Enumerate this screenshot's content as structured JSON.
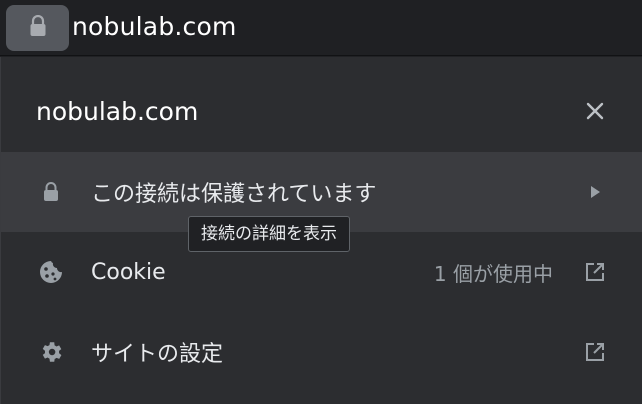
{
  "omnibox": {
    "url": "nobulab.com",
    "icon": "lock-icon"
  },
  "panel": {
    "title": "nobulab.com",
    "close_icon": "close-icon",
    "rows": [
      {
        "label": "この接続は保護されています",
        "icon": "lock-icon",
        "action_icon": "chevron-right-icon"
      },
      {
        "label": "Cookie",
        "status": "1 個が使用中",
        "icon": "cookie-icon",
        "action_icon": "open-external-icon"
      },
      {
        "label": "サイトの設定",
        "icon": "gear-icon",
        "action_icon": "open-external-icon"
      }
    ]
  },
  "tooltip": {
    "text": "接続の詳細を表示"
  },
  "colors": {
    "background": "#202124",
    "panel": "#2c2d30",
    "row_hover": "#3b3c40",
    "text": "#e8eaed",
    "muted": "#9aa0a6"
  }
}
